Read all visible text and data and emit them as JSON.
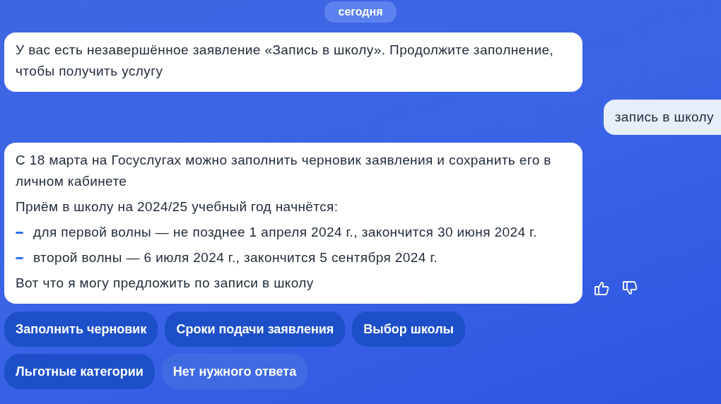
{
  "date_label": "сегодня",
  "messages": [
    {
      "kind": "bot",
      "paragraphs": [
        {
          "kind": "text",
          "text": "У вас есть незавершённое заявление «Запись в школу». Продолжите заполнение, чтобы получить услугу"
        }
      ]
    },
    {
      "kind": "user",
      "paragraphs": [
        {
          "kind": "text",
          "text": "запись в школу"
        }
      ]
    },
    {
      "kind": "bot",
      "feedback": true,
      "paragraphs": [
        {
          "kind": "text",
          "text": "С 18 марта на Госуслугах можно заполнить черновик заявления и сохранить его в личном кабинете"
        },
        {
          "kind": "text",
          "text": "Приём в школу на 2024/25 учебный год начнётся:"
        },
        {
          "kind": "bullet",
          "text": "для первой волны — не позднее 1 апреля 2024 г., закончится 30 июня 2024 г."
        },
        {
          "kind": "bullet",
          "text": "второй волны — 6 июля 2024 г., закончится 5 сентября 2024 г."
        },
        {
          "kind": "text",
          "text": "Вот что я могу предложить по записи в школу"
        }
      ]
    }
  ],
  "quick_replies": [
    {
      "label": "Заполнить черновик",
      "kind": "primary"
    },
    {
      "label": "Сроки подачи заявления",
      "kind": "primary"
    },
    {
      "label": "Выбор школы",
      "kind": "primary"
    },
    {
      "label": "Льготные категории",
      "kind": "primary"
    },
    {
      "label": "Нет нужного ответа",
      "kind": "secondary"
    }
  ]
}
